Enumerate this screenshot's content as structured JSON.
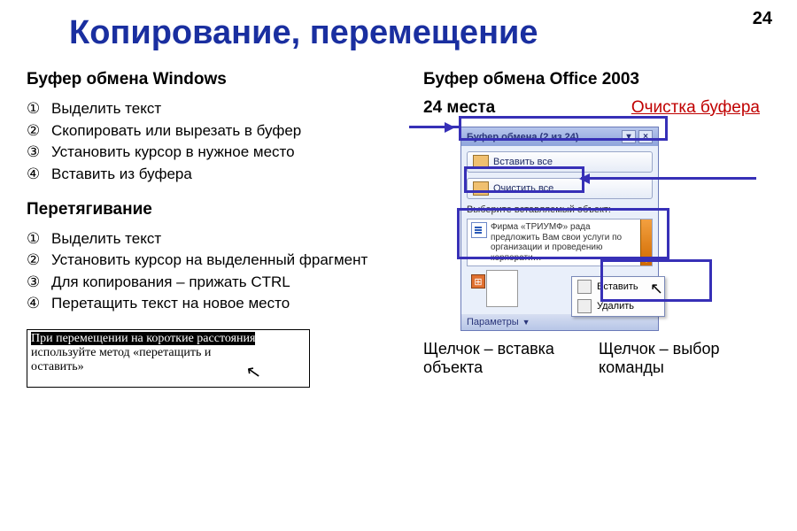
{
  "page_number": "24",
  "title": "Копирование, перемещение",
  "left": {
    "windows_heading": "Буфер обмена Windows",
    "windows_steps": [
      "Выделить текст",
      "Скопировать или вырезать в буфер",
      "Установить курсор в нужное место",
      "Вставить из буфера"
    ],
    "drag_heading": "Перетягивание",
    "drag_steps": [
      "Выделить текст",
      "Установить курсор на выделенный фрагмент",
      "Для копирования – прижать CTRL",
      "Перетащить текст на новое место"
    ],
    "note_line1": "При перемещении на короткие расстояния",
    "note_line2": "используйте метод «перетащить и",
    "note_line3": "оставить»"
  },
  "right": {
    "office_heading": "Буфер обмена Office 2003",
    "places_label": "24 места",
    "clear_label": "Очистка буфера",
    "pane": {
      "title": "Буфер обмена (2 из 24)",
      "paste_all": "Вставить все",
      "clear_all": "Очистить все",
      "instruction": "Выберите вставляемый объект:",
      "item_text": "Фирма «ТРИУМФ» рада предложить Вам свои услуги по организации и проведению корпорати…",
      "menu_paste": "Вставить",
      "menu_delete": "Удалить",
      "params": "Параметры"
    },
    "caption_click_insert": "Щелчок – вставка объекта",
    "caption_click_command": "Щелчок – выбор команды"
  },
  "circled_nums": [
    "①",
    "②",
    "③",
    "④"
  ]
}
